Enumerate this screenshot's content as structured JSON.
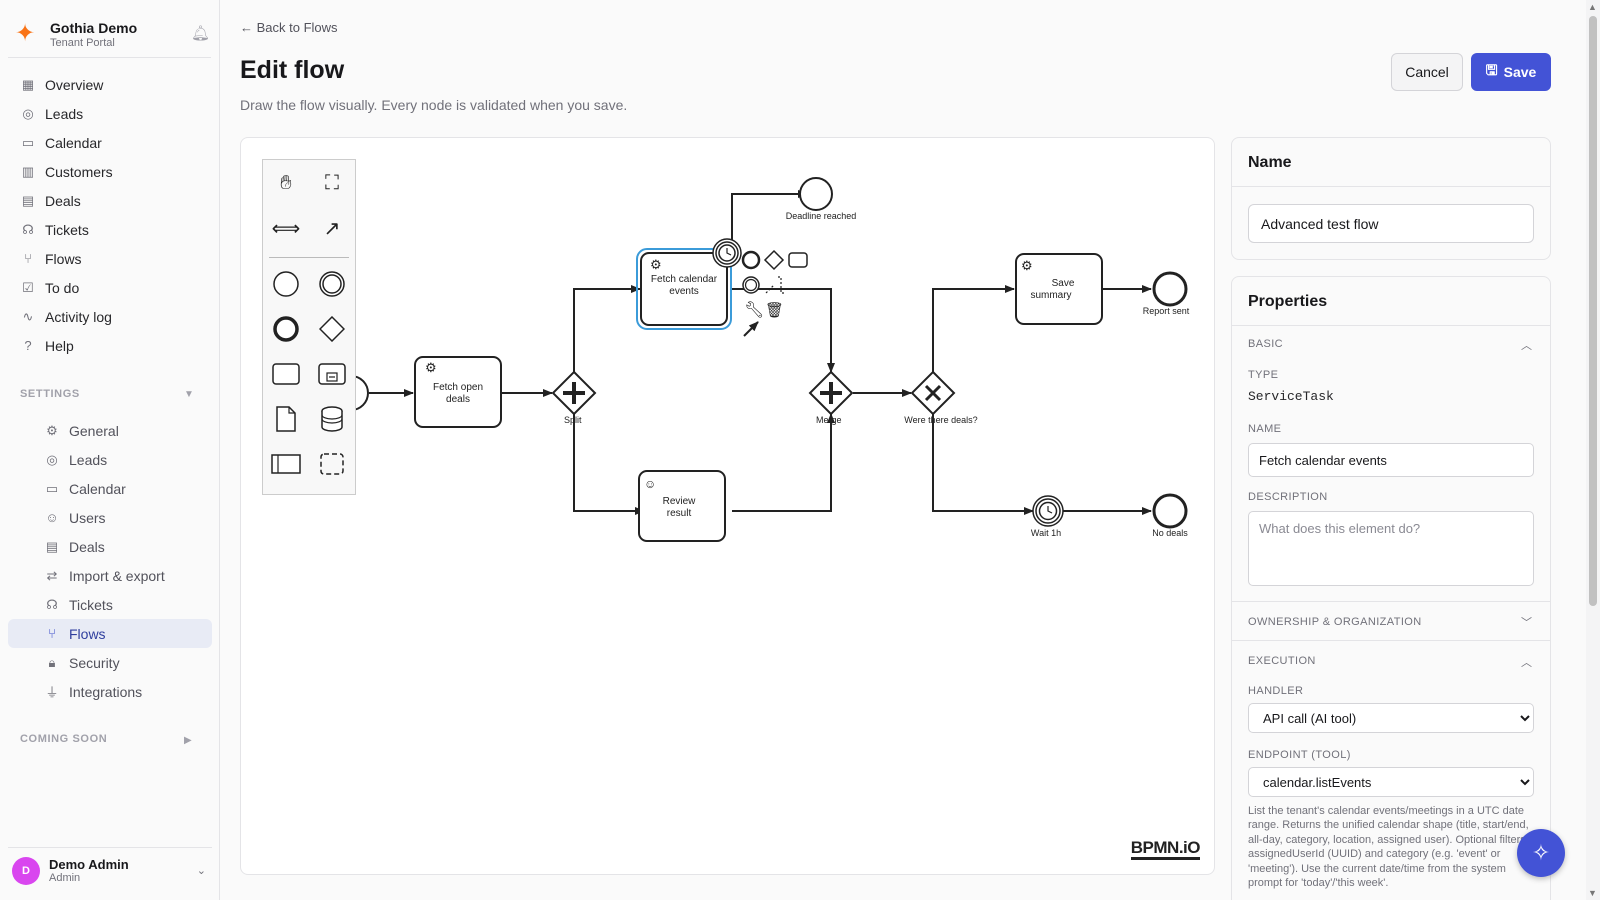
{
  "brand": {
    "title": "Gothia Demo",
    "subtitle": "Tenant Portal",
    "logo_icon": "sparkle-icon",
    "accent": "#f97316"
  },
  "nav": {
    "items": [
      {
        "label": "Overview",
        "icon": "grid-icon"
      },
      {
        "label": "Leads",
        "icon": "target-icon"
      },
      {
        "label": "Calendar",
        "icon": "calendar-icon"
      },
      {
        "label": "Customers",
        "icon": "building-icon"
      },
      {
        "label": "Deals",
        "icon": "briefcase-icon"
      },
      {
        "label": "Tickets",
        "icon": "headset-icon"
      },
      {
        "label": "Flows",
        "icon": "flow-icon"
      },
      {
        "label": "To do",
        "icon": "checkbox-icon"
      },
      {
        "label": "Activity log",
        "icon": "activity-icon"
      },
      {
        "label": "Help",
        "icon": "help-icon"
      }
    ],
    "settings_label": "SETTINGS",
    "settings_items": [
      {
        "label": "General",
        "icon": "gear-icon"
      },
      {
        "label": "Leads",
        "icon": "target-icon"
      },
      {
        "label": "Calendar",
        "icon": "calendar-icon"
      },
      {
        "label": "Users",
        "icon": "users-icon"
      },
      {
        "label": "Deals",
        "icon": "briefcase-icon"
      },
      {
        "label": "Import & export",
        "icon": "arrows-icon"
      },
      {
        "label": "Tickets",
        "icon": "headset-icon"
      },
      {
        "label": "Flows",
        "icon": "flow-icon",
        "active": true
      },
      {
        "label": "Security",
        "icon": "lock-icon"
      },
      {
        "label": "Integrations",
        "icon": "plug-icon"
      }
    ],
    "coming_soon_label": "COMING SOON"
  },
  "user": {
    "name": "Demo Admin",
    "role": "Admin",
    "initial": "D"
  },
  "header": {
    "back_label": "Back to Flows",
    "title": "Edit flow",
    "description": "Draw the flow visually. Every node is validated when you save.",
    "cancel_label": "Cancel",
    "save_label": "Save"
  },
  "diagram": {
    "nodes": {
      "fetch_open_deals": "Fetch open deals",
      "split": "Split",
      "fetch_calendar_events": "Fetch calendar events",
      "deadline_reached": "Deadline reached",
      "review_result": "Review result",
      "merge": "Merge",
      "were_there_deals": "Were there deals?",
      "save_summary": "Save summary",
      "report_sent": "Report sent",
      "wait_1h": "Wait 1h",
      "no_deals": "No deals"
    },
    "logo": "BPMN.iO"
  },
  "name_panel": {
    "title": "Name",
    "value": "Advanced test flow"
  },
  "properties": {
    "title": "Properties",
    "basic_label": "BASIC",
    "type_label": "TYPE",
    "type_value": "ServiceTask",
    "name_label": "NAME",
    "name_value": "Fetch calendar events",
    "description_label": "DESCRIPTION",
    "description_placeholder": "What does this element do?",
    "ownership_label": "OWNERSHIP & ORGANIZATION",
    "execution_label": "EXECUTION",
    "handler_label": "HANDLER",
    "handler_value": "API call (AI tool)",
    "endpoint_label": "ENDPOINT (TOOL)",
    "endpoint_value": "calendar.listEvents",
    "help_text": "List the tenant's calendar events/meetings in a UTC date range. Returns the unified calendar shape (title, start/end, all-day, category, location, assigned user). Optional filters: assignedUserId (UUID) and category (e.g. 'event' or 'meeting'). Use the current date/time from the system prompt for 'today'/'this week'."
  },
  "colors": {
    "primary": "#4353d6",
    "selection": "#3b9bd9"
  }
}
